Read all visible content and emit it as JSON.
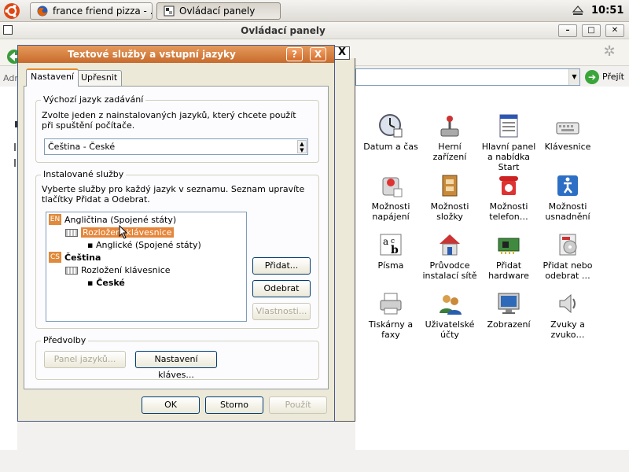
{
  "top_panel": {
    "tasks": [
      {
        "label": "france friend pizza - …",
        "icon": "firefox-icon"
      },
      {
        "label": "Ovládací panely",
        "icon": "window-icon"
      }
    ],
    "clock": "10:51"
  },
  "bg_window": {
    "title": "Ovládací panely",
    "address_label": "Adre",
    "go_label": "Přejít",
    "items": [
      {
        "label": "Datum a čas",
        "icon": "clock-icon"
      },
      {
        "label": "Herní zařízení",
        "icon": "joystick-icon"
      },
      {
        "label": "Hlavní panel a nabídka Start",
        "icon": "taskbar-icon"
      },
      {
        "label": "Klávesnice",
        "icon": "keyboard-icon"
      },
      {
        "label": "Možnosti napájení",
        "icon": "power-icon"
      },
      {
        "label": "Možnosti složky",
        "icon": "folder-options-icon"
      },
      {
        "label": "Možnosti telefon…",
        "icon": "phone-icon"
      },
      {
        "label": "Možnosti usnadnění",
        "icon": "accessibility-icon"
      },
      {
        "label": "Písma",
        "icon": "fonts-icon"
      },
      {
        "label": "Průvodce instalací sítě",
        "icon": "network-wizard-icon"
      },
      {
        "label": "Přidat hardware",
        "icon": "hardware-icon"
      },
      {
        "label": "Přidat nebo odebrat …",
        "icon": "add-remove-icon"
      },
      {
        "label": "Tiskárny a faxy",
        "icon": "printer-icon"
      },
      {
        "label": "Uživatelské účty",
        "icon": "users-icon"
      },
      {
        "label": "Zobrazení",
        "icon": "display-icon"
      },
      {
        "label": "Zvuky a zvuko…",
        "icon": "sound-icon"
      }
    ]
  },
  "dialog": {
    "title": "Textové služby a vstupní jazyky",
    "help": "?",
    "close": "X",
    "outer_close": "X",
    "tabs": [
      "Nastavení",
      "Upřesnit"
    ],
    "default_lang": {
      "legend": "Výchozí jazyk zadávání",
      "text": "Zvolte jeden z nainstalovaných jazyků, který chcete použít při spuštění počítače.",
      "value": "Čeština - České"
    },
    "installed": {
      "legend": "Instalované služby",
      "text": "Vyberte služby pro každý jazyk v seznamu. Seznam upravíte tlačítky Přidat a Odebrat.",
      "tree": {
        "en_tag": "EN",
        "en_lang": "Angličtina (Spojené státy)",
        "en_layout_group": "Rozložení klávesnice",
        "en_layout": "Anglické (Spojené státy)",
        "cs_tag": "CS",
        "cs_lang": "Čeština",
        "cs_layout_group": "Rozložení klávesnice",
        "cs_layout": "České"
      },
      "buttons": {
        "add": "Přidat...",
        "remove": "Odebrat",
        "properties": "Vlastnosti..."
      }
    },
    "prefs": {
      "legend": "Předvolby",
      "lang_bar": "Panel jazyků...",
      "key_settings": "Nastavení kláves..."
    },
    "footer": {
      "ok": "OK",
      "cancel": "Storno",
      "apply": "Použít"
    }
  }
}
